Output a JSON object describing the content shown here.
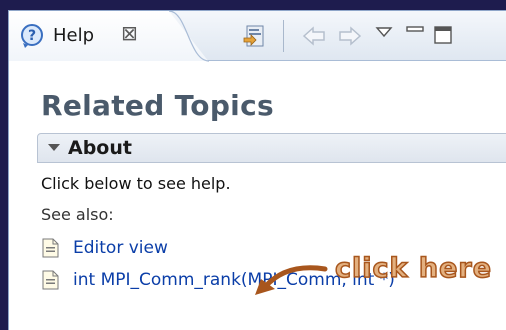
{
  "tab": {
    "label": "Help",
    "close_glyph": "⊠",
    "icon": "help-icon"
  },
  "toolbar": {
    "icons": [
      "show-in-contents-icon",
      "back-icon",
      "forward-icon",
      "view-menu-icon",
      "minimize-icon",
      "maximize-icon"
    ]
  },
  "page": {
    "title": "Related Topics"
  },
  "section": {
    "title": "About",
    "description": "Click below to see help.",
    "see_also": "See also:",
    "links": [
      {
        "label": "Editor view",
        "icon": "document-icon"
      },
      {
        "label": "int MPI_Comm_rank(MPI_Comm, int *)",
        "icon": "document-icon"
      }
    ]
  },
  "annotation": {
    "text": "click here",
    "color": "#e3b07f"
  },
  "colors": {
    "background": "#1e1c4e",
    "link": "#0b3ea8",
    "title": "#4a5a6b"
  }
}
